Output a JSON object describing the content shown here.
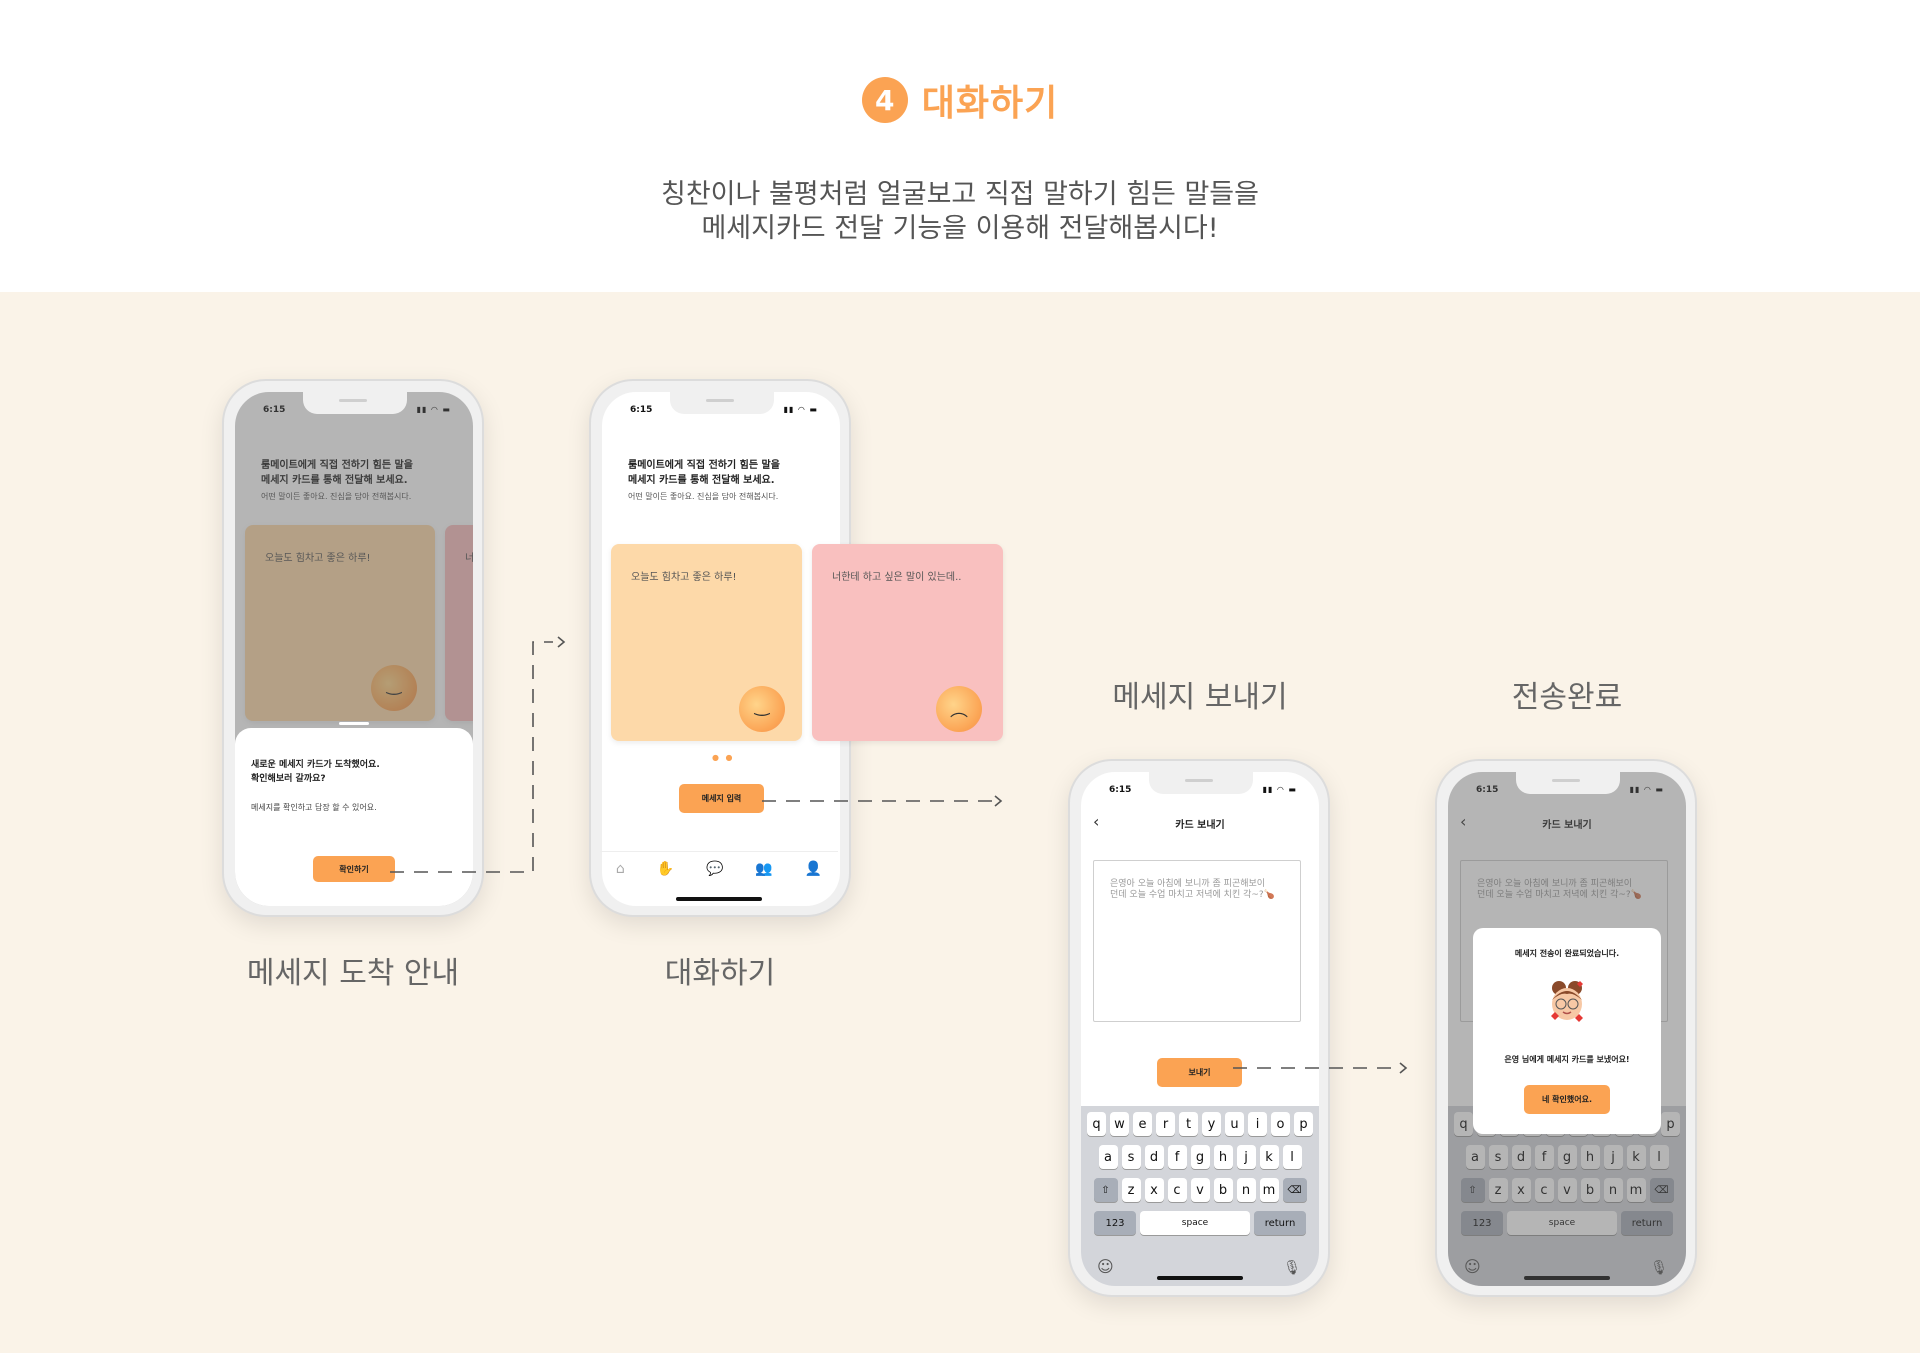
{
  "header": {
    "step_number": "4",
    "title": "대화하기",
    "intro_line1": "칭찬이나 불평처럼 얼굴보고 직접 말하기 힘든 말들을",
    "intro_line2": "메세지카드 전달 기능을 이용해 전달해봅시다!"
  },
  "captions": {
    "screen1": "메세지 도착 안내",
    "screen2": "대화하기",
    "screen3": "메세지 보내기",
    "screen4": "전송완료"
  },
  "status": {
    "time": "6:15",
    "icons": "▮▮ ◠ ▬"
  },
  "chat_screen": {
    "intro_title_line1": "룸메이트에게 직접 전하기 힘든 말을",
    "intro_title_line2": "메세지 카드를 통해 전달해 보세요.",
    "intro_sub": "어떤 말이든 좋아요. 진심을 담아 전해봅시다.",
    "card1_text": "오늘도 힘차고 좋은 하루!",
    "card2_text": "너한테 하고 싶은 말이 있는데..",
    "card2_peek": "너",
    "happy_face": "‿",
    "sad_face": "︵",
    "pager": "● ●",
    "send_button": "메세지 입력",
    "tabs": [
      "⌂",
      "✋",
      "💬",
      "👥",
      "👤"
    ]
  },
  "arrival_sheet": {
    "title_line1": "새로운 메세지 카드가 도착했어요.",
    "title_line2": "확인해보러 갈까요?",
    "sub": "메세지를 확인하고 답장 할 수 있어요.",
    "confirm_button": "확인하기"
  },
  "compose_screen": {
    "back": "‹",
    "nav_title": "카드 보내기",
    "message_line1": "은영아 오늘 아침에 보니까 좀 피곤해보이",
    "message_line2": "던데 오늘 수업 마치고 저녁에 치킨 각~?🍗",
    "send_button": "보내기"
  },
  "keyboard": {
    "row1": [
      "q",
      "w",
      "e",
      "r",
      "t",
      "y",
      "u",
      "i",
      "o",
      "p"
    ],
    "row2": [
      "a",
      "s",
      "d",
      "f",
      "g",
      "h",
      "j",
      "k",
      "l"
    ],
    "row3": [
      "z",
      "x",
      "c",
      "v",
      "b",
      "n",
      "m"
    ],
    "shift": "⇧",
    "delete": "⌫",
    "numbers": "123",
    "space": "space",
    "return": "return",
    "emoji": "☺",
    "mic": "🎙"
  },
  "complete_modal": {
    "title": "메세지 전송이 완료되었습니다.",
    "sub": "은영 님에게 메세지 카드를 보냈어요!",
    "ok_button": "네 확인했어요."
  },
  "colors": {
    "accent": "#fba353",
    "stage_bg": "#faf3e8",
    "card_yellow": "#fdd9a9",
    "card_pink": "#f9c0bf"
  }
}
